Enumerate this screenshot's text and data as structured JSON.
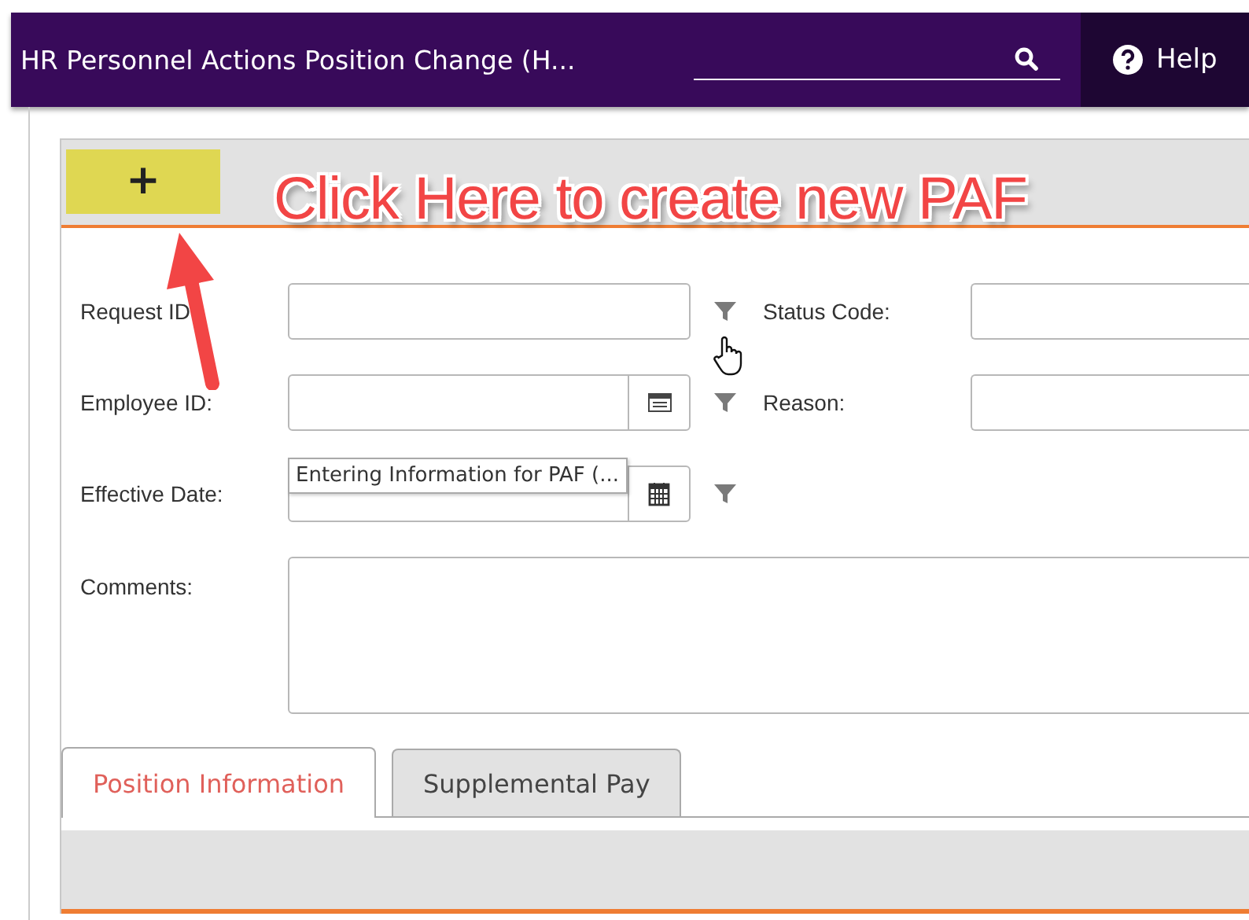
{
  "header": {
    "title": "HR Personnel Actions Position Change (H...",
    "help": "Help"
  },
  "toolbar": {
    "add_button": "+"
  },
  "annotation": {
    "text": "Click Here to create new PAF"
  },
  "form": {
    "rows": [
      {
        "left": {
          "label": "Request ID",
          "kind": "text",
          "filter": true
        },
        "right": {
          "label": "Status Code:"
        }
      },
      {
        "left": {
          "label": "Employee ID:",
          "kind": "lookup",
          "filter": true
        },
        "right": {
          "label": "Reason:"
        }
      },
      {
        "left": {
          "label": "Effective Date:",
          "kind": "date",
          "filter": true
        }
      },
      {
        "left": {
          "label": "Comments:",
          "kind": "textarea",
          "filter": false
        }
      }
    ]
  },
  "tooltip": "Entering Information for PAF (...",
  "tabs": [
    {
      "label": "Position Information",
      "selected": true
    },
    {
      "label": "Supplemental Pay",
      "selected": false
    }
  ]
}
